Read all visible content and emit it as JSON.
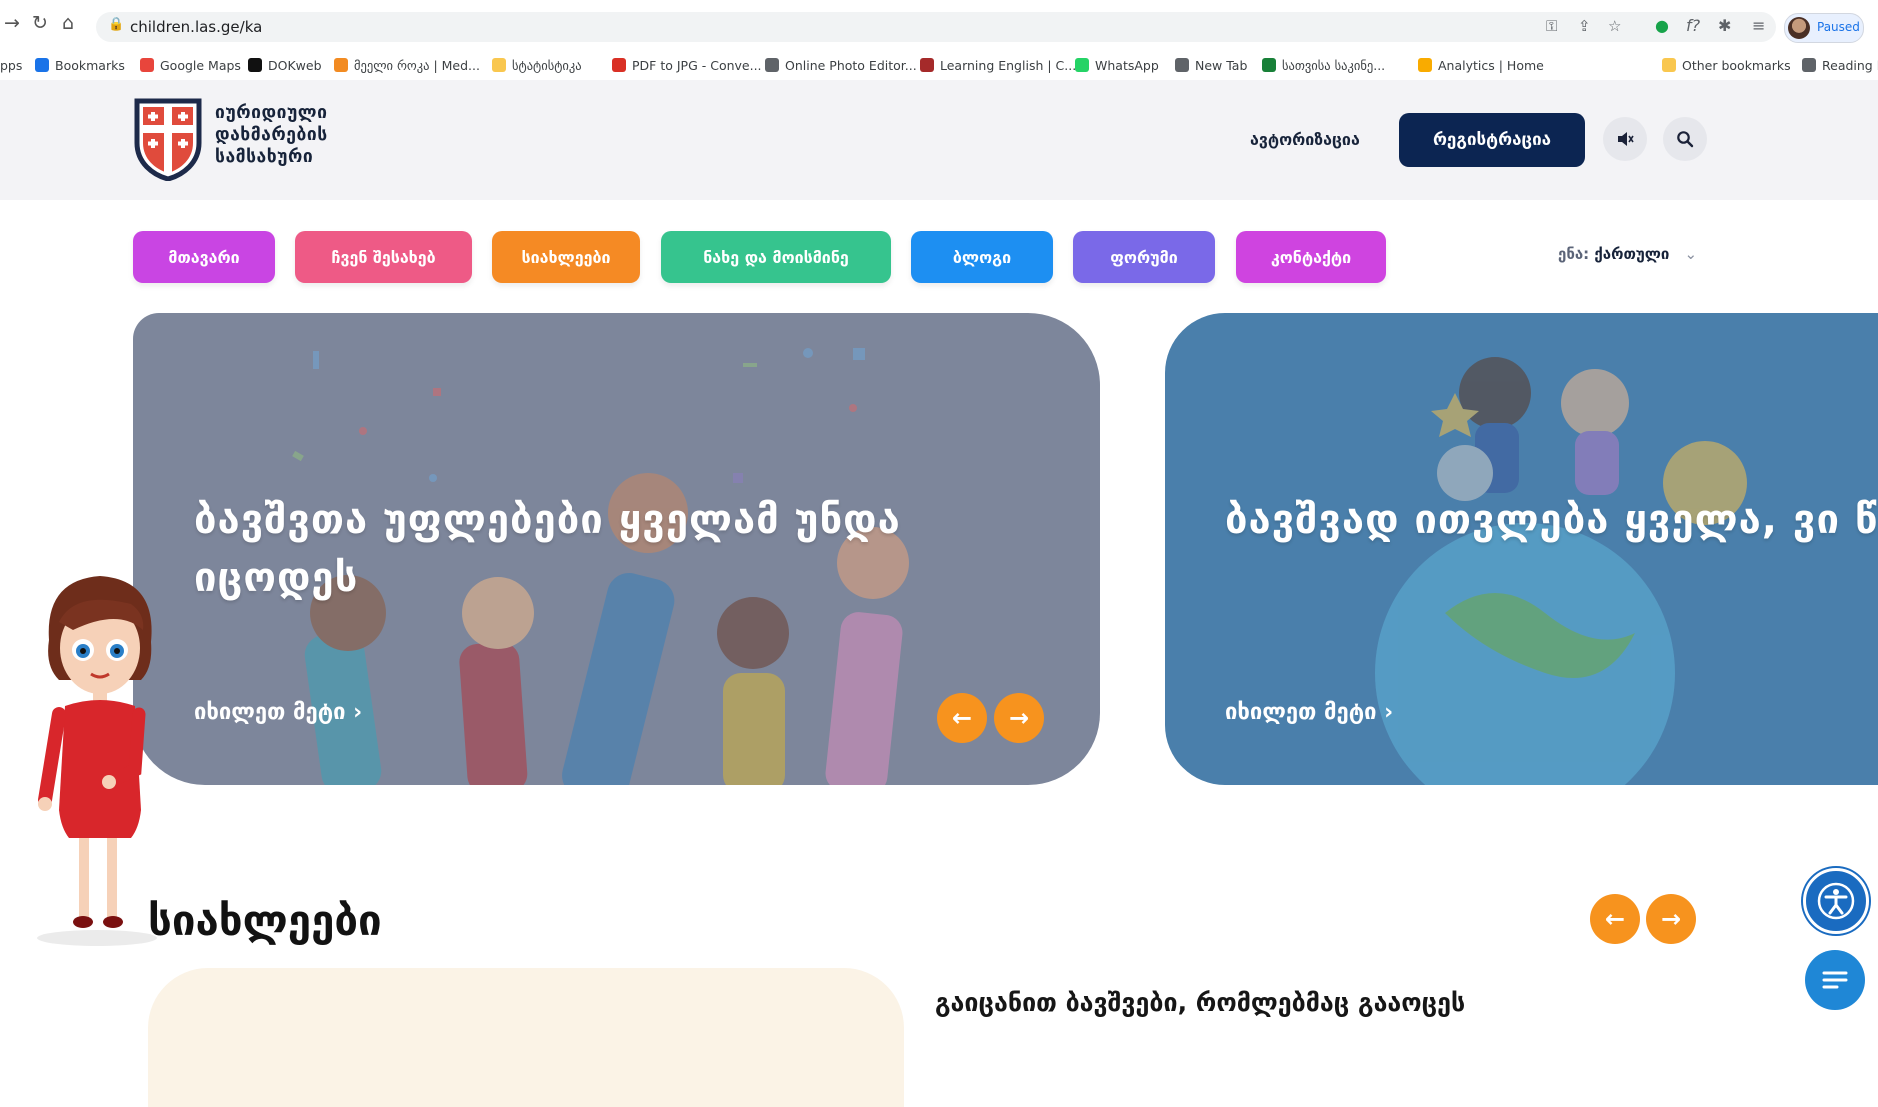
{
  "browser": {
    "url": "children.las.ge/ka",
    "profile_status": "Paused",
    "bookmarks": [
      {
        "label": "pps",
        "icon": "apps-icon"
      },
      {
        "label": "Bookmarks",
        "icon": "star-icon"
      },
      {
        "label": "Google Maps",
        "icon": "map-pin-icon"
      },
      {
        "label": "DOKweb",
        "icon": "dokweb-icon"
      },
      {
        "label": "მეელი როკა | Med...",
        "icon": "bookmark-icon"
      },
      {
        "label": "სტატისტიკა",
        "icon": "folder-icon"
      },
      {
        "label": "PDF to JPG - Conve...",
        "icon": "pdf-icon"
      },
      {
        "label": "Online Photo Editor...",
        "icon": "globe-icon"
      },
      {
        "label": "Learning English | C...",
        "icon": "shield-icon"
      },
      {
        "label": "WhatsApp",
        "icon": "whatsapp-icon"
      },
      {
        "label": "New Tab",
        "icon": "globe-icon"
      },
      {
        "label": "სათვისა საკინე...",
        "icon": "info-icon"
      },
      {
        "label": "Analytics | Home",
        "icon": "analytics-icon"
      },
      {
        "label": "Other bookmarks",
        "icon": "folder-icon"
      },
      {
        "label": "Reading l",
        "icon": "reading-list-icon"
      }
    ]
  },
  "header": {
    "logo_lines": [
      "იურიდიული",
      "დახმარების",
      "სამსახური"
    ],
    "auth_label": "ავტორიზაცია",
    "register_label": "რეგისტრაცია"
  },
  "nav": {
    "items": [
      {
        "label": "მთავარი",
        "color": "#c945e3"
      },
      {
        "label": "ჩვენ შესახებ",
        "color": "#ee5a86"
      },
      {
        "label": "სიახლეები",
        "color": "#f58a24"
      },
      {
        "label": "ნახე და მოისმინე",
        "color": "#36c48e"
      },
      {
        "label": "ბლოგი",
        "color": "#1d8ff2"
      },
      {
        "label": "ფორუმი",
        "color": "#7a69e8"
      },
      {
        "label": "კონტაქტი",
        "color": "#cf44e0"
      }
    ],
    "language_label": "ენა:",
    "language_value": "ქართული"
  },
  "hero": {
    "slides": [
      {
        "title": "ბავშვთა უფლებები ყველამ უნდა იცოდეს",
        "more": "იხილეთ მეტი ›"
      },
      {
        "title": "ბავშვად ითვლება ყველა, ვი წელი ჯერ არ შესრულებია.",
        "more": "იხილეთ მეტი ›"
      }
    ],
    "prev_symbol": "←",
    "next_symbol": "→"
  },
  "news": {
    "title": "სიახლეები",
    "caption": "გაიცანით ბავშვები, რომლებმაც გააოცეს"
  },
  "colors": {
    "accent_orange": "#f7931e",
    "navy": "#0c2552",
    "header_bg": "#f3f3f6"
  }
}
